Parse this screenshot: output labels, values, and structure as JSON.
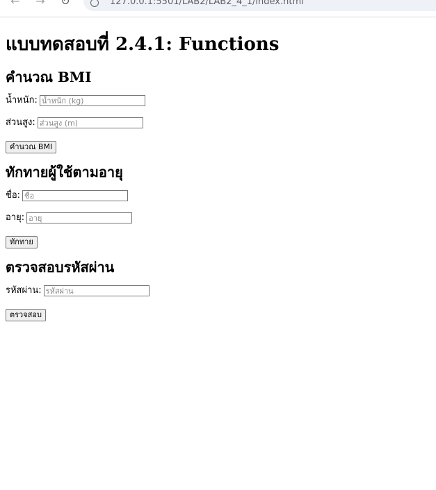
{
  "browser": {
    "url": "127.0.0.1:5501/LAB2/LAB2_4_1/index.html"
  },
  "page": {
    "title": "แบบทดสอบที่ 2.4.1: Functions"
  },
  "bmi": {
    "heading": "คำนวณ BMI",
    "weight_label": "น้ำหนัก:",
    "weight_placeholder": "น้ำหนัก (kg)",
    "height_label": "ส่วนสูง:",
    "height_placeholder": "ส่วนสูง (m)",
    "button_label": "คำนวณ BMI"
  },
  "greet": {
    "heading": "ทักทายผู้ใช้ตามอายุ",
    "name_label": "ชื่อ:",
    "name_placeholder": "ชื่อ",
    "age_label": "อายุ:",
    "age_placeholder": "อายุ",
    "button_label": "ทักทาย"
  },
  "password": {
    "heading": "ตรวจสอบรหัสผ่าน",
    "password_label": "รหัสผ่าน:",
    "password_placeholder": "รหัสผ่าน",
    "button_label": "ตรวจสอบ"
  }
}
